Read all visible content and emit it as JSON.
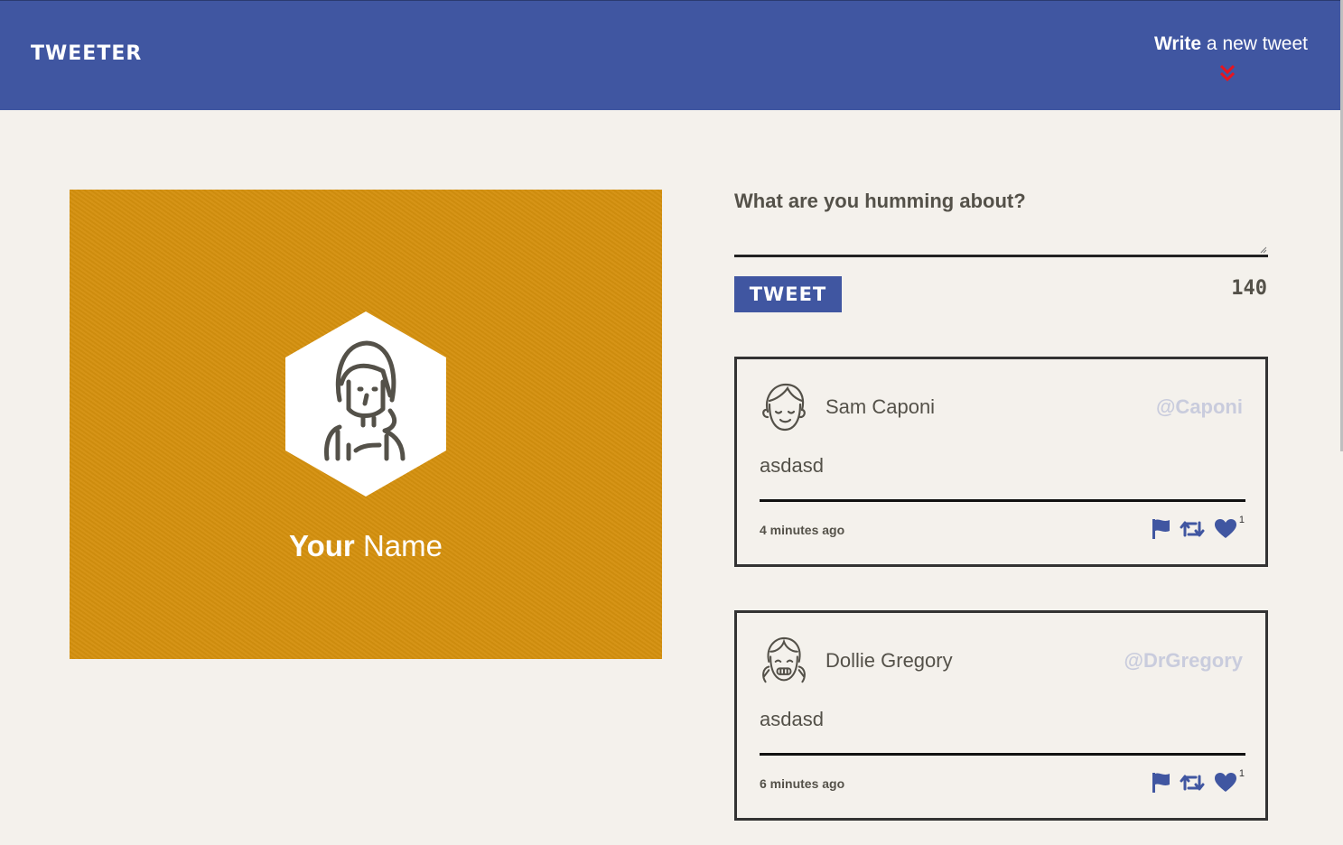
{
  "nav": {
    "brand": "TWEETER",
    "write_bold": "Write",
    "write_rest": " a new tweet",
    "bg_color": "#4056a1",
    "chevron_color": "#e8141e"
  },
  "profile": {
    "first": "Your",
    "last": "Name",
    "bg_color": "#d4900e"
  },
  "compose": {
    "label": "What are you humming about?",
    "value": "",
    "button": "TWEET",
    "counter": "140"
  },
  "tweets": [
    {
      "name": "Sam Caponi",
      "handle": "@Caponi",
      "content": "asdasd",
      "time": "4 minutes ago",
      "likes": "1",
      "avatar_icon": "boy-avatar-icon"
    },
    {
      "name": "Dollie Gregory",
      "handle": "@DrGregory",
      "content": "asdasd",
      "time": "6 minutes ago",
      "likes": "1",
      "avatar_icon": "girl-avatar-icon"
    }
  ]
}
